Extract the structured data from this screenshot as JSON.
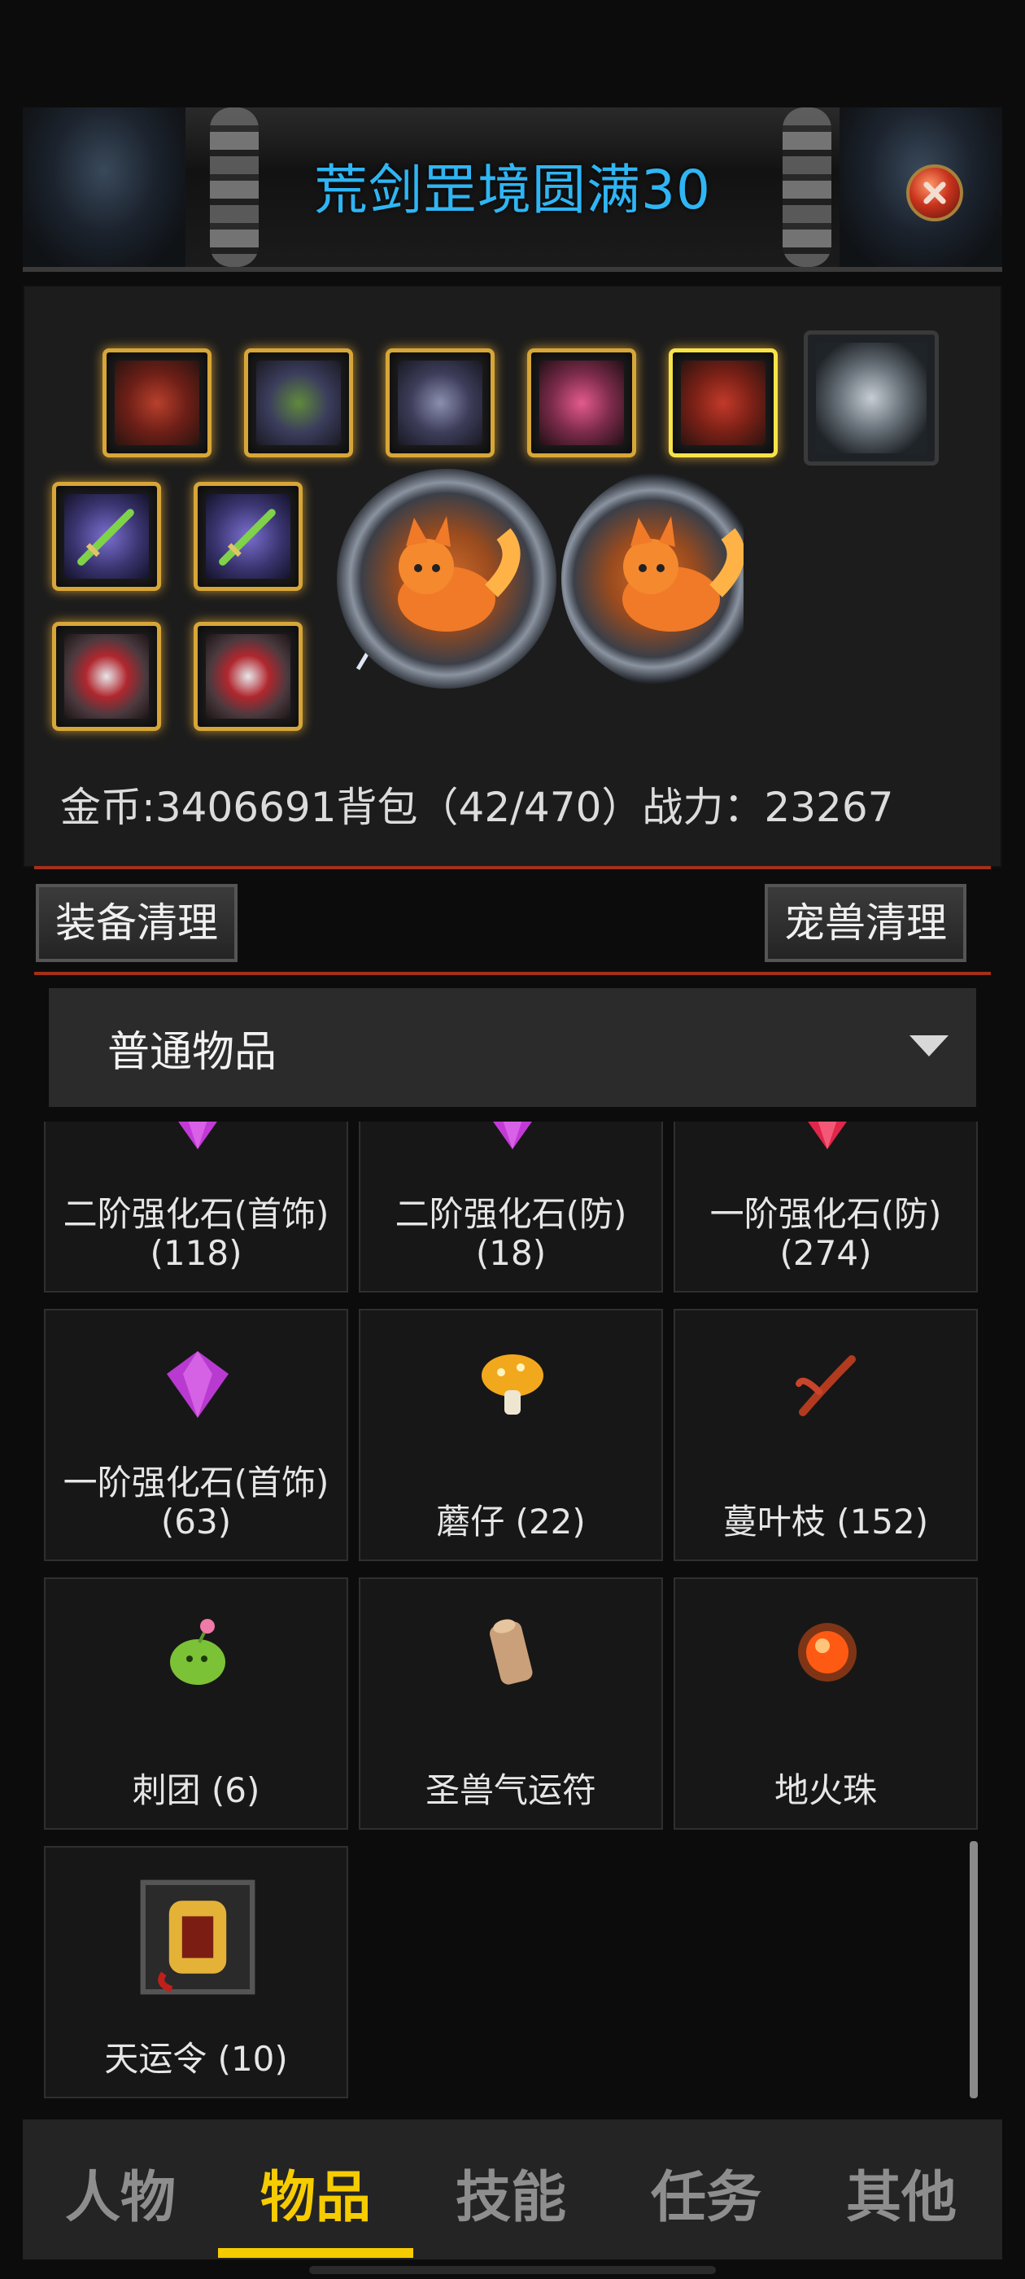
{
  "header": {
    "title": "荒剑罡境圆满30",
    "close_icon": "close-icon"
  },
  "equipment": {
    "row1": [
      "helmet-icon",
      "shoulder-armor-icon",
      "demon-mask-icon",
      "glove-icon",
      "armor-icon",
      "stone-icon"
    ],
    "row2": [
      "green-sword-icon",
      "green-sword-icon"
    ],
    "row3": [
      "ring-icon",
      "ring-icon"
    ],
    "character": "swordsman-character",
    "pets": [
      "fox-pet-icon",
      "fox-pet-icon"
    ]
  },
  "stats": {
    "text": "金币:3406691背包（42/470）战力：23267"
  },
  "actions": {
    "equip_clean": "装备清理",
    "pet_clean": "宠兽清理"
  },
  "filter": {
    "selected": "普通物品"
  },
  "items": [
    {
      "label": "二阶强化石(首饰) (118)",
      "icon": "purple-gem-icon",
      "color": "#c23ad6"
    },
    {
      "label": "二阶强化石(防) (18)",
      "icon": "purple-gem-icon",
      "color": "#c23ad6"
    },
    {
      "label": "一阶强化石(防) (274)",
      "icon": "red-gem-icon",
      "color": "#e0264a"
    },
    {
      "label": "一阶强化石(首饰) (63)",
      "icon": "purple-gem-icon",
      "color": "#b83ad0"
    },
    {
      "label": "蘑仔 (22)",
      "icon": "mushroom-icon",
      "color": "#f2a81c"
    },
    {
      "label": "蔓叶枝 (152)",
      "icon": "branch-icon",
      "color": "#b23a1f"
    },
    {
      "label": "刺团 (6)",
      "icon": "cactus-icon",
      "color": "#7bc236"
    },
    {
      "label": "圣兽气运符",
      "icon": "scroll-icon",
      "color": "#c9a07a"
    },
    {
      "label": "地火珠",
      "icon": "fire-orb-icon",
      "color": "#ff5a14"
    },
    {
      "label": "天运令 (10)",
      "icon": "token-icon",
      "color": "#e3b237"
    }
  ],
  "tabs": [
    {
      "label": "人物"
    },
    {
      "label": "物品"
    },
    {
      "label": "技能"
    },
    {
      "label": "任务"
    },
    {
      "label": "其他"
    }
  ],
  "active_tab": "物品",
  "colors": {
    "title": "#2fb5f3",
    "accent": "#f6cc00",
    "divider": "#a4301a"
  }
}
